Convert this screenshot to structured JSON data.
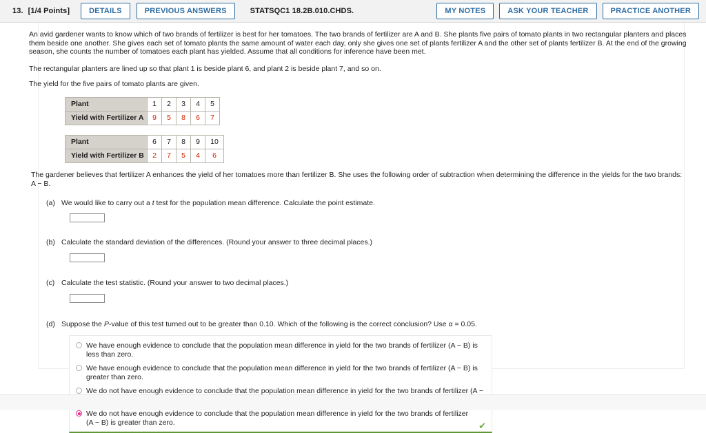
{
  "header": {
    "question_number": "13.",
    "points": "[1/4 Points]",
    "details_label": "DETAILS",
    "previous_answers_label": "PREVIOUS ANSWERS",
    "question_code": "STATSQC1 18.2B.010.CHDS.",
    "my_notes_label": "MY NOTES",
    "ask_teacher_label": "ASK YOUR TEACHER",
    "practice_another_label": "PRACTICE ANOTHER",
    "accent_color": "#2d6ca2"
  },
  "problem": {
    "intro": "An avid gardener wants to know which of two brands of fertilizer is best for her tomatoes. The two brands of fertilizer are A and B. She plants five pairs of tomato plants in two rectangular planters and places them beside one another. She gives each set of tomato plants the same amount of water each day, only she gives one set of plants fertilizer A and the other set of plants fertilizer B. At the end of the growing season, she counts the number of tomatoes each plant has yielded. Assume that all conditions for inference have been met.",
    "lineup": "The rectangular planters are lined up so that plant 1 is beside plant 6, and plant 2 is beside plant 7, and so on.",
    "yield_note": "The yield for the five pairs of tomato plants are given.",
    "belief": "The gardener believes that fertilizer A enhances the yield of her tomatoes more than fertilizer B. She uses the following order of subtraction when determining the difference in the yields for the two brands: A − B."
  },
  "chart_data": {
    "type": "table",
    "title": "Yield for the five pairs of tomato plants",
    "tables": [
      {
        "row_header_1": "Plant",
        "row_header_2": "Yield with Fertilizer A",
        "plants": [
          "1",
          "2",
          "3",
          "4",
          "5"
        ],
        "yields": [
          "9",
          "5",
          "8",
          "6",
          "7"
        ]
      },
      {
        "row_header_1": "Plant",
        "row_header_2": "Yield with Fertilizer B",
        "plants": [
          "6",
          "7",
          "8",
          "9",
          "10"
        ],
        "yields": [
          "2",
          "7",
          "5",
          "4",
          "6"
        ]
      }
    ],
    "value_color": "#cc2200",
    "header_bg": "#d5d2cb"
  },
  "parts": {
    "a": {
      "label": "(a)",
      "text_before": "We would like to carry out a ",
      "italic": "t",
      "text_after": " test for the population mean difference. Calculate the point estimate.",
      "answer_value": "",
      "placeholder": ""
    },
    "b": {
      "label": "(b)",
      "text": "Calculate the standard deviation of the differences. (Round your answer to three decimal places.)",
      "answer_value": "",
      "placeholder": ""
    },
    "c": {
      "label": "(c)",
      "text": "Calculate the test statistic. (Round your answer to two decimal places.)",
      "answer_value": "",
      "placeholder": ""
    },
    "d": {
      "label": "(d)",
      "text_before": "Suppose the ",
      "italic": "P",
      "text_after": "-value of this test turned out to be greater than 0.10. Which of the following is the correct conclusion? Use α = 0.05.",
      "options": [
        {
          "text": "We have enough evidence to conclude that the population mean difference in yield for the two brands of fertilizer (A − B) is less than zero.",
          "selected": false
        },
        {
          "text": "We have enough evidence to conclude that the population mean difference in yield for the two brands of fertilizer (A − B) is greater than zero.",
          "selected": false
        },
        {
          "text": "We do not have enough evidence to conclude that the population mean difference in yield for the two brands of fertilizer (A − B) is less than zero.",
          "selected": false
        },
        {
          "text": "We do not have enough evidence to conclude that the population mean difference in yield for the two brands of fertilizer (A − B) is greater than zero.",
          "selected": true
        }
      ],
      "correct_mark": "✔",
      "correct_color": "#6aaa44",
      "selected_color": "#e0218a"
    }
  }
}
